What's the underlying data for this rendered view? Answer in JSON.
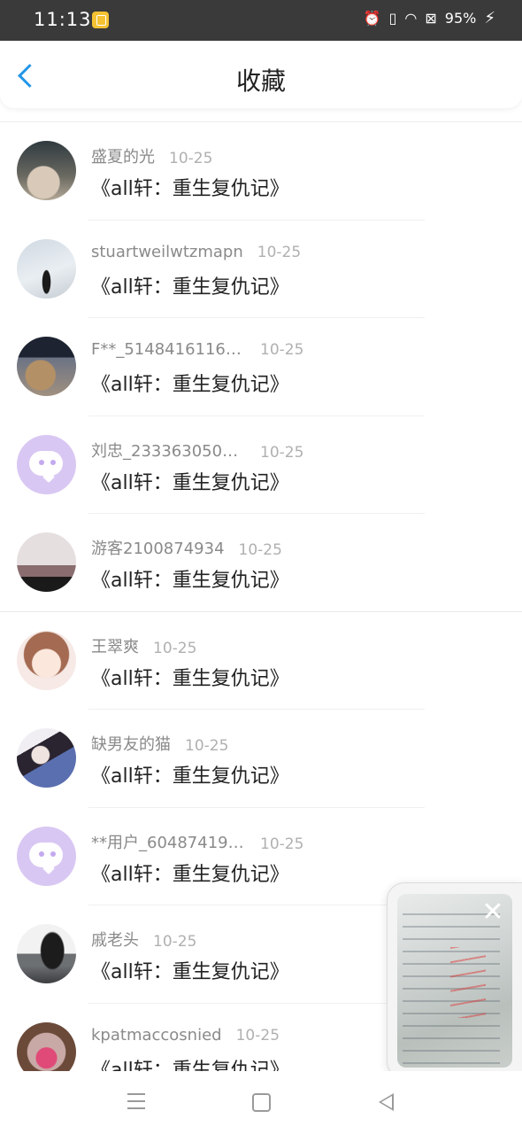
{
  "status_bar": {
    "time": "11:13",
    "battery": "95%",
    "icons": [
      "alarm-icon",
      "vibrate-icon",
      "wifi-icon",
      "battery-saver-icon",
      "charging-icon"
    ]
  },
  "header": {
    "title": "收藏",
    "back_icon": "chevron-left-icon"
  },
  "favorites": [
    {
      "user": "盛夏的光",
      "date": "10-25",
      "book": "《all轩：重生复仇记》",
      "avatar": "photo"
    },
    {
      "user": "stuartweilwtzmapn",
      "date": "10-25",
      "book": "《all轩：重生复仇记》",
      "avatar": "photo"
    },
    {
      "user": "F**_51484161162...",
      "date": "10-25",
      "book": "《all轩：重生复仇记》",
      "avatar": "photo"
    },
    {
      "user": "刘忠_2333630504...",
      "date": "10-25",
      "book": "《all轩：重生复仇记》",
      "avatar": "default"
    },
    {
      "user": "游客2100874934",
      "date": "10-25",
      "book": "《all轩：重生复仇记》",
      "avatar": "photo"
    },
    {
      "user": "王翠爽",
      "date": "10-25",
      "book": "《all轩：重生复仇记》",
      "avatar": "photo"
    },
    {
      "user": "缺男友的猫",
      "date": "10-25",
      "book": "《all轩：重生复仇记》",
      "avatar": "photo"
    },
    {
      "user": "**用户_604874198...",
      "date": "10-25",
      "book": "《all轩：重生复仇记》",
      "avatar": "default"
    },
    {
      "user": "戚老头",
      "date": "10-25",
      "book": "《all轩：重生复仇记》",
      "avatar": "photo"
    },
    {
      "user": "kpatmaccosnied",
      "date": "10-25",
      "book": "《all轩：重生复仇记》",
      "avatar": "photo"
    }
  ],
  "floating_window": {
    "close_icon": "close-icon"
  },
  "nav_bar": {
    "icons": [
      "menu-icon",
      "home-icon",
      "back-triangle-icon"
    ]
  },
  "colors": {
    "accent": "#2196e8",
    "status_bar": "#3a3a3a",
    "default_avatar": "#d9c7f3"
  }
}
